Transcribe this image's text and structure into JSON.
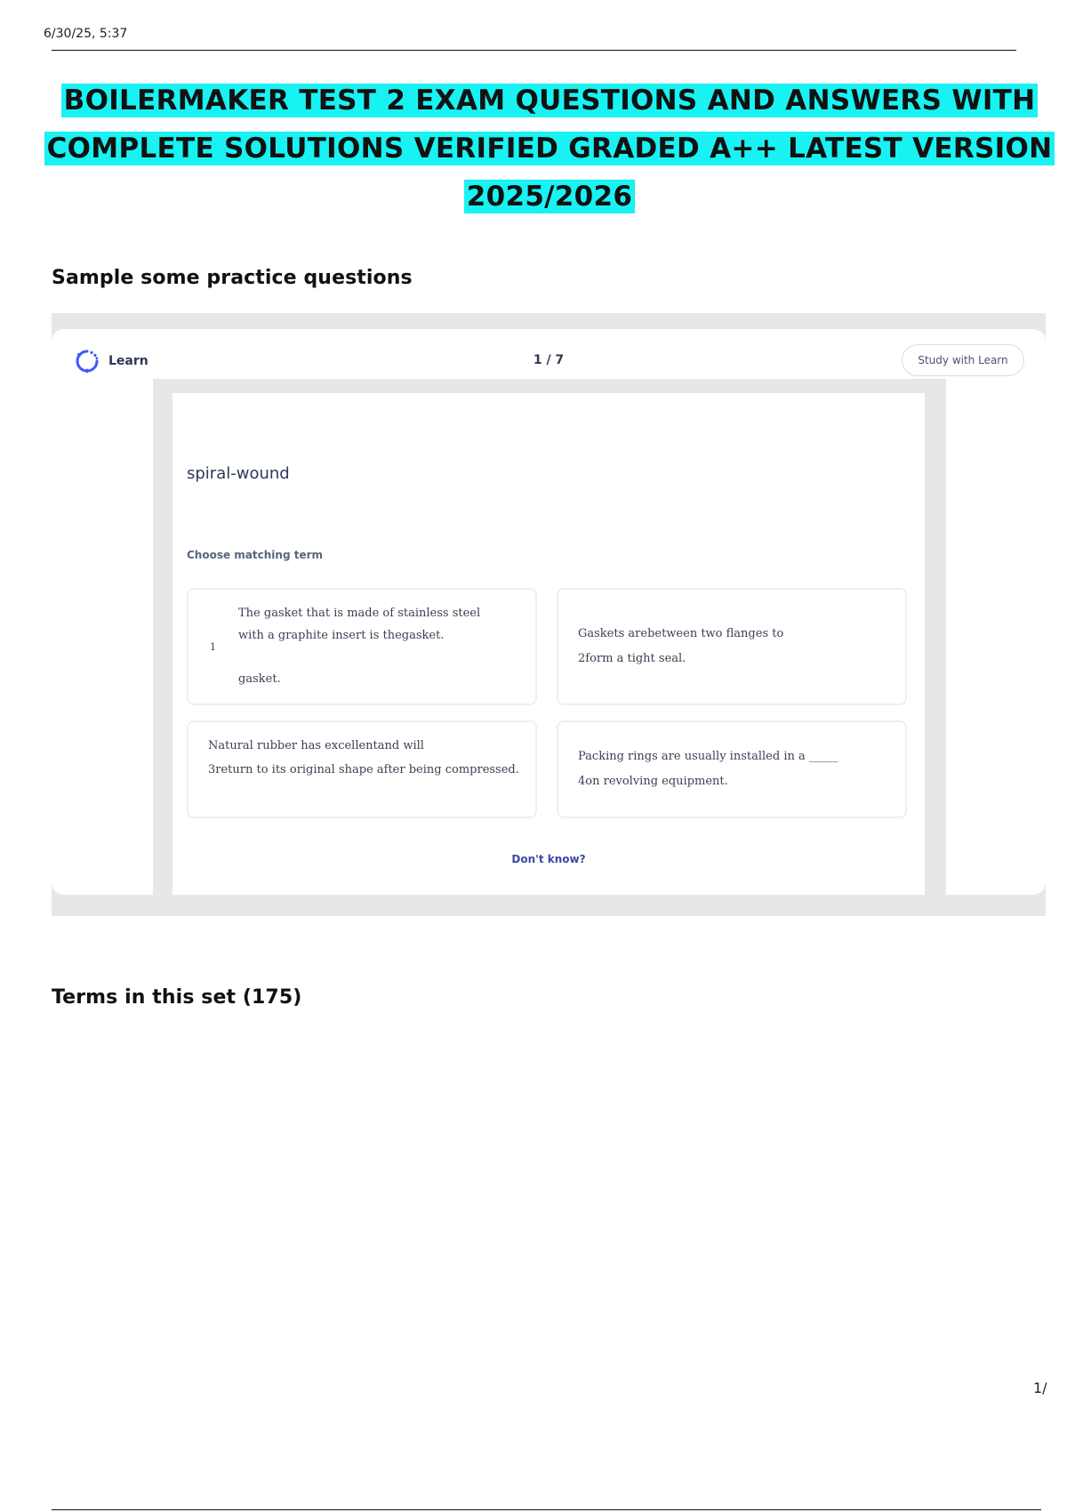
{
  "header": {
    "timestamp": "6/30/25, 5:37"
  },
  "title": {
    "line1": "BOILERMAKER TEST 2 EXAM QUESTIONS AND ANSWERS WITH",
    "line2": "COMPLETE SOLUTIONS VERIFIED GRADED A++ LATEST VERSION",
    "line3": "2025/2026",
    "highlight_color": "#19f2f2"
  },
  "practice_heading": "Sample some practice questions",
  "widget": {
    "learn_label": "Learn",
    "learn_icon": "learn-loop-icon",
    "counter": "1 / 7",
    "study_button": "Study with Learn",
    "term": "spiral-wound",
    "choose_label": "Choose matching term",
    "options": [
      {
        "number": "1",
        "lines": [
          "The gasket that is made of stainless steel",
          "with a graphite insert is thegasket.",
          "gasket."
        ]
      },
      {
        "lines": [
          "Gaskets arebetween two flanges to",
          "2form a tight seal."
        ]
      },
      {
        "lines": [
          "Natural rubber has excellentand will",
          "3return to its original shape after being compressed."
        ]
      },
      {
        "lines": [
          "Packing rings are usually installed in a _____",
          "4on revolving equipment."
        ]
      }
    ],
    "dont_know": "Don't know?"
  },
  "terms_heading": "Terms in this set (175)",
  "footer": {
    "page_number": "1/"
  }
}
